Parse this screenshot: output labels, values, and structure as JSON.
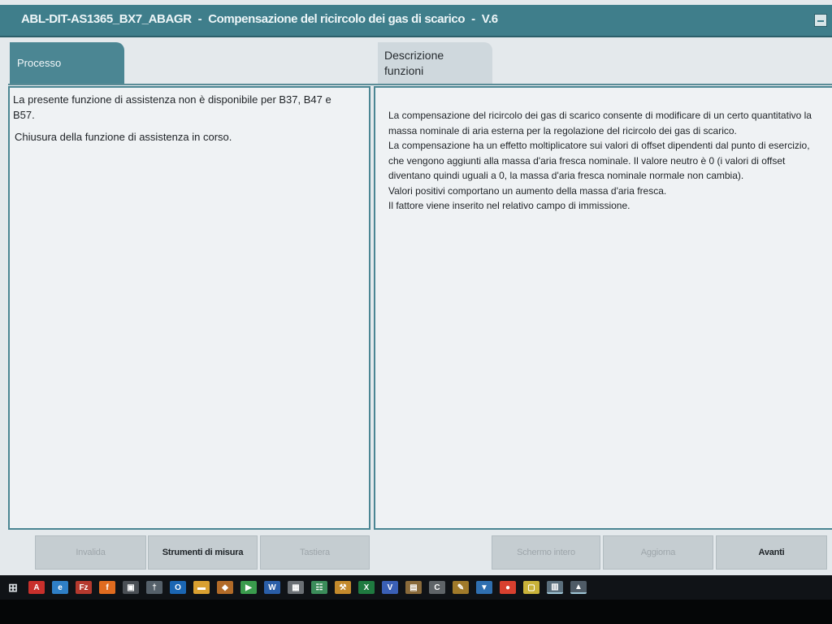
{
  "window": {
    "title_code": "ABL-DIT-AS1365_BX7_ABAGR",
    "title_name": "Compensazione del ricircolo dei gas di scarico",
    "title_version": "V.6",
    "separator": "-"
  },
  "tabs": {
    "processo": "Processo",
    "descrizione_line1": "Descrizione",
    "descrizione_line2": "funzioni"
  },
  "left_panel": {
    "message_1": "La presente funzione di assistenza non è disponibile per B37, B47 e B57.",
    "message_2": "Chiusura della funzione di assistenza in corso."
  },
  "right_panel": {
    "paragraphs": [
      "La compensazione del ricircolo dei gas di scarico consente di modificare di un certo quantitativo la massa nominale di aria esterna per la regolazione del ricircolo dei gas di scarico.",
      "La compensazione ha un effetto moltiplicatore sui valori di offset dipendenti dal punto di esercizio, che vengono aggiunti alla massa d'aria fresca nominale. Il valore neutro è 0 (i valori di offset diventano quindi uguali a 0, la massa d'aria fresca nominale normale non cambia).",
      "Valori positivi comportano un aumento della massa d'aria fresca.",
      "Il fattore viene inserito nel relativo campo di immissione."
    ]
  },
  "buttons": {
    "invalida": "Invalida",
    "strumenti": "Strumenti di misura",
    "tastiera": "Tastiera",
    "schermo": "Schermo intero",
    "aggiorna": "Aggiorna",
    "avanti": "Avanti"
  },
  "taskbar": {
    "icons": [
      {
        "name": "start-icon",
        "glyph": "⊞",
        "color": "#101317"
      },
      {
        "name": "acrobat-icon",
        "glyph": "A",
        "color": "#c9302c"
      },
      {
        "name": "browser-icon",
        "glyph": "e",
        "color": "#2f7fc6"
      },
      {
        "name": "filezilla-icon",
        "glyph": "Fz",
        "color": "#b5392e"
      },
      {
        "name": "firefox-icon",
        "glyph": "f",
        "color": "#e06b1f"
      },
      {
        "name": "app-window-icon",
        "glyph": "▣",
        "color": "#4a4f55"
      },
      {
        "name": "usb-icon",
        "glyph": "†",
        "color": "#55606a"
      },
      {
        "name": "outlook-icon",
        "glyph": "O",
        "color": "#1b66b3"
      },
      {
        "name": "folder-icon",
        "glyph": "▬",
        "color": "#d9a031"
      },
      {
        "name": "package-icon",
        "glyph": "◆",
        "color": "#b26b28"
      },
      {
        "name": "media-icon",
        "glyph": "▶",
        "color": "#3a9b4d"
      },
      {
        "name": "word-icon",
        "glyph": "W",
        "color": "#2a5ea8"
      },
      {
        "name": "calculator-icon",
        "glyph": "▦",
        "color": "#6b7075"
      },
      {
        "name": "network-icon",
        "glyph": "☷",
        "color": "#3b8c5a"
      },
      {
        "name": "tool-icon",
        "glyph": "⚒",
        "color": "#c48a2c"
      },
      {
        "name": "excel-icon",
        "glyph": "X",
        "color": "#1f7a40"
      },
      {
        "name": "visio-icon",
        "glyph": "V",
        "color": "#3a5fb5"
      },
      {
        "name": "diagnosis-icon",
        "glyph": "▤",
        "color": "#8a6a3a"
      },
      {
        "name": "terminal-icon",
        "glyph": "C",
        "color": "#5f6468"
      },
      {
        "name": "wrench-icon",
        "glyph": "✎",
        "color": "#a07a2a"
      },
      {
        "name": "shield-icon",
        "glyph": "▼",
        "color": "#2f6fb0"
      },
      {
        "name": "chrome-icon",
        "glyph": "●",
        "color": "#d8402f"
      },
      {
        "name": "notes-icon",
        "glyph": "▢",
        "color": "#c9b23a"
      },
      {
        "name": "explorer-icon",
        "glyph": "▥",
        "color": "#5b6f7d"
      },
      {
        "name": "photos-icon",
        "glyph": "▲",
        "color": "#4f5b66"
      }
    ]
  }
}
